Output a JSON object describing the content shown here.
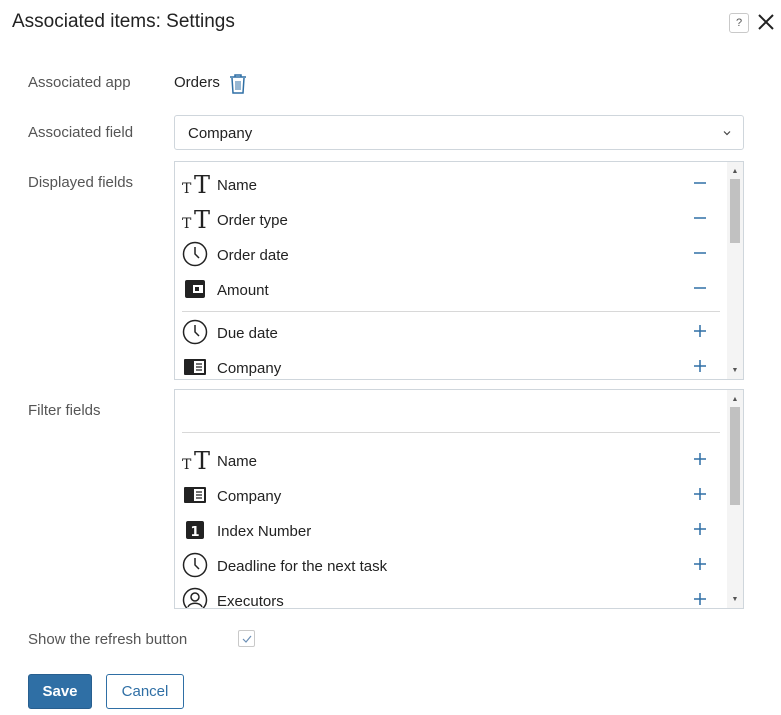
{
  "dialog": {
    "title": "Associated items: Settings",
    "help_label": "?",
    "close_icon": "close-icon"
  },
  "form": {
    "associated_app_label": "Associated app",
    "associated_app_value": "Orders",
    "associated_field_label": "Associated field",
    "associated_field_value": "Company",
    "displayed_fields_label": "Displayed fields",
    "filter_fields_label": "Filter fields",
    "refresh_label": "Show the refresh button",
    "refresh_checked": true
  },
  "displayed_fields": {
    "selected": [
      {
        "label": "Name",
        "icon": "text-icon",
        "action": "remove"
      },
      {
        "label": "Order type",
        "icon": "text-icon",
        "action": "remove"
      },
      {
        "label": "Order date",
        "icon": "clock-icon",
        "action": "remove"
      },
      {
        "label": "Amount",
        "icon": "wallet-icon",
        "action": "remove"
      }
    ],
    "available": [
      {
        "label": "Due date",
        "icon": "clock-icon",
        "action": "add"
      },
      {
        "label": "Company",
        "icon": "card-icon",
        "action": "add"
      }
    ]
  },
  "filter_fields": {
    "selected": [],
    "available": [
      {
        "label": "Name",
        "icon": "text-icon",
        "action": "add"
      },
      {
        "label": "Company",
        "icon": "card-icon",
        "action": "add"
      },
      {
        "label": "Index Number",
        "icon": "number-icon",
        "action": "add"
      },
      {
        "label": "Deadline for the next task",
        "icon": "clock-icon",
        "action": "add"
      },
      {
        "label": "Executors",
        "icon": "user-icon",
        "action": "add"
      }
    ]
  },
  "buttons": {
    "save": "Save",
    "cancel": "Cancel"
  },
  "colors": {
    "accent": "#2f6fa5",
    "border": "#cfd6dc"
  }
}
